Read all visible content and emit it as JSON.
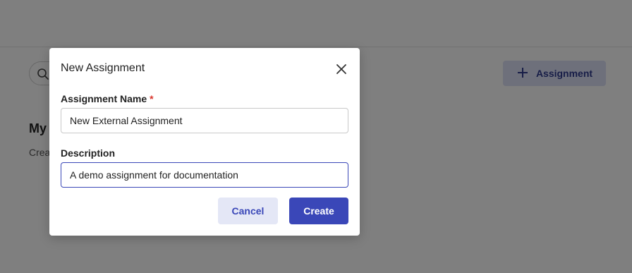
{
  "background": {
    "heading": "My",
    "description": "Crea                                                                                    ck and grades.",
    "add_button_label": "Assignment"
  },
  "modal": {
    "title": "New Assignment",
    "name_label": "Assignment Name",
    "required_marker": "*",
    "name_value": "New External Assignment",
    "description_label": "Description",
    "description_value": "A demo assignment for documentation",
    "cancel_label": "Cancel",
    "create_label": "Create"
  },
  "colors": {
    "accent": "#3a47b8",
    "accent_light": "#e4e7f6",
    "required": "#d9342b"
  },
  "icons": {
    "search": "search-icon",
    "add": "plus-icon",
    "close": "close-icon"
  }
}
